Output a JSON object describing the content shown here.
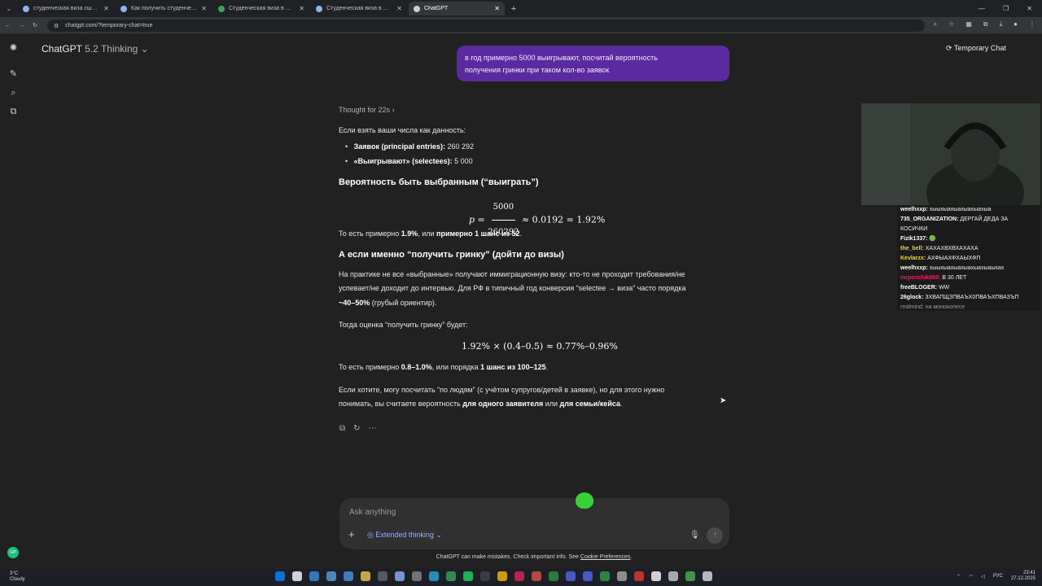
{
  "browser": {
    "tabs": [
      {
        "title": "студенческая виза сша учитс...",
        "active": false
      },
      {
        "title": "Как получить студенческую в...",
        "active": false
      },
      {
        "title": "Студенческая виза в США - к...",
        "active": false
      },
      {
        "title": "Студенческая виза в США: св...",
        "active": false
      },
      {
        "title": "ChatGPT",
        "active": true
      }
    ],
    "url": "chatgpt.com/?temporary-chat=true"
  },
  "header": {
    "model_name": "ChatGPT",
    "model_version": "5.2 Thinking",
    "temporary_chat": "Temporary Chat"
  },
  "user_message": {
    "line1": "в год примерно 5000 выигрывают, посчитай вероятность",
    "line2": "получения гринки при таком кол-во заявок"
  },
  "answer": {
    "thought": "Thought for 22s",
    "intro": "Если взять ваши числа как данность:",
    "bullet1_label": "Заявок (principal entries):",
    "bullet1_value": " 260 292",
    "bullet2_label": "«Выигрывают» (selectees):",
    "bullet2_value": " 5 000",
    "heading1": "Вероятность быть выбранным (“выиграть”)",
    "formula1_lhs": "p =",
    "formula1_num": "5000",
    "formula1_den": "260292",
    "formula1_rhs": "≈ 0.0192 = 1.92%",
    "line_a1": "То есть примерно ",
    "line_a2": "1.9%",
    "line_a3": ", или ",
    "line_a4": "примерно 1 шанс из 52",
    "line_a5": ".",
    "heading2": "А если именно “получить гринку” (дойти до визы)",
    "para1_l1": "На практике не все «выбранные» получают иммиграционную визу: кто-то не проходит требования/не",
    "para1_l2": "успевает/не доходит до интервью. Для РФ в типичный год конверсия “selectee → виза” часто порядка",
    "para1_l3_bold": "~40–50%",
    "para1_l3_rest": " (грубый ориентир).",
    "estimate_intro": "Тогда оценка “получить гринку” будет:",
    "formula2": "1.92% × (0.4–0.5) ≈ 0.77%–0.96%",
    "line_b1": "То есть примерно ",
    "line_b2": "0.8–1.0%",
    "line_b3": ", или порядка ",
    "line_b4": "1 шанс из 100–125",
    "line_b5": ".",
    "closing_l1": "Если хотите, могу посчитать “по людям” (с учётом супругов/детей в заявке), но для этого нужно",
    "closing_l2a": "понимать, вы считаете вероятность ",
    "closing_l2b": "для одного заявителя",
    "closing_l2c": " или ",
    "closing_l2d": "для семьи/кейса",
    "closing_l2e": "."
  },
  "composer": {
    "placeholder": "Ask anything",
    "extended_thinking": "Extended thinking"
  },
  "disclaimer": {
    "text": "ChatGPT can make mistakes. Check important info. See ",
    "link": "Cookie Preferences",
    "end": "."
  },
  "stream_chat": [
    {
      "user": "weelhxxp:",
      "text": " хыыхыахыахыахыахыа",
      "color": "#ffffff"
    },
    {
      "user": "735_ORGANIZATION:",
      "text": " ДЕРГАЙ ДЕДА ЗА",
      "color": "#ffffff"
    },
    {
      "user": "",
      "text": "КОСИЧКИ",
      "color": "#ffffff"
    },
    {
      "user": "Fizik1337:",
      "text": " 🟢",
      "color": "#ffffff"
    },
    {
      "user": "the_bell:",
      "text": " ХАХАХВХВХАХАХА",
      "color": "#f5d90a"
    },
    {
      "user": "Kevlarzx:",
      "text": " АХФЫАХФХАЫХФП",
      "color": "#f5d90a"
    },
    {
      "user": "weelhxxp:",
      "text": " хыыхыахыахыахыахыаыхах",
      "color": "#ffffff"
    },
    {
      "user": "mrpenchik669:",
      "text": " В 30 ЛЕТ",
      "color": "#e0245e"
    },
    {
      "user": "freeBLOGER:",
      "text": " WW",
      "color": "#ffffff"
    },
    {
      "user": "26glock:",
      "text": " ЗХВАПЩЗПВАЪХ0ПВАЪХПВАЗЪП",
      "color": "#ffffff"
    }
  ],
  "stream_chat_last": {
    "user": "realmind:",
    "text": " на моноколесе"
  },
  "taskbar": {
    "temp": "3°C",
    "weather": "Cloudy",
    "lang": "РУС",
    "time": "23:41",
    "date": "27.12.2025"
  },
  "avatar_initials": "GP"
}
